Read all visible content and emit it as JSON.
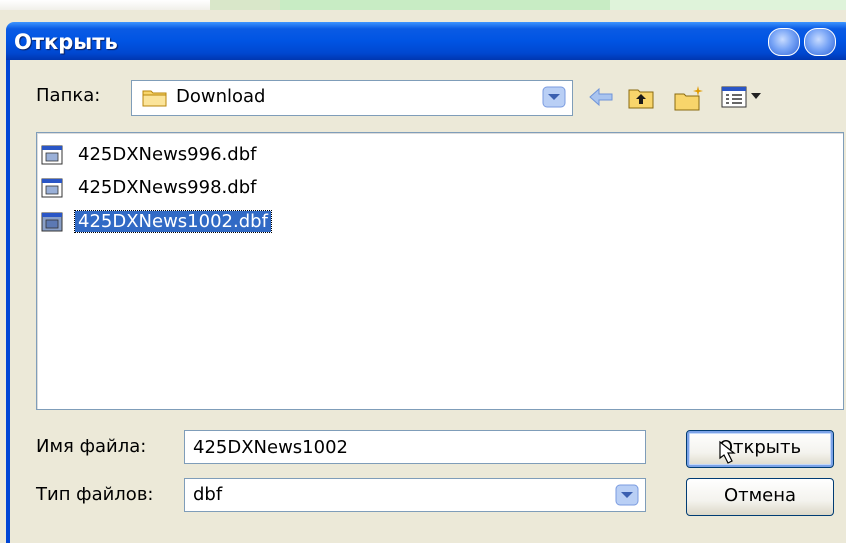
{
  "window": {
    "title": "Открыть"
  },
  "lookin": {
    "label": "Папка:",
    "folder": "Download"
  },
  "files": [
    {
      "name": "425DXNews996.dbf",
      "selected": false
    },
    {
      "name": "425DXNews998.dbf",
      "selected": false
    },
    {
      "name": "425DXNews1002.dbf",
      "selected": true
    }
  ],
  "filename": {
    "label": "Имя файла:",
    "value": "425DXNews1002"
  },
  "filetype": {
    "label": "Тип файлов:",
    "value": "dbf"
  },
  "buttons": {
    "open": "Открыть",
    "cancel": "Отмена"
  },
  "icons": {
    "folder": "folder-icon",
    "back": "back-arrow-icon",
    "up": "up-folder-icon",
    "new_folder": "new-folder-icon",
    "view": "view-menu-icon",
    "file": "dbf-file-icon"
  },
  "colors": {
    "titlebar": "#0054e3",
    "selection": "#316ac5",
    "dialog_bg": "#ece9d8"
  }
}
